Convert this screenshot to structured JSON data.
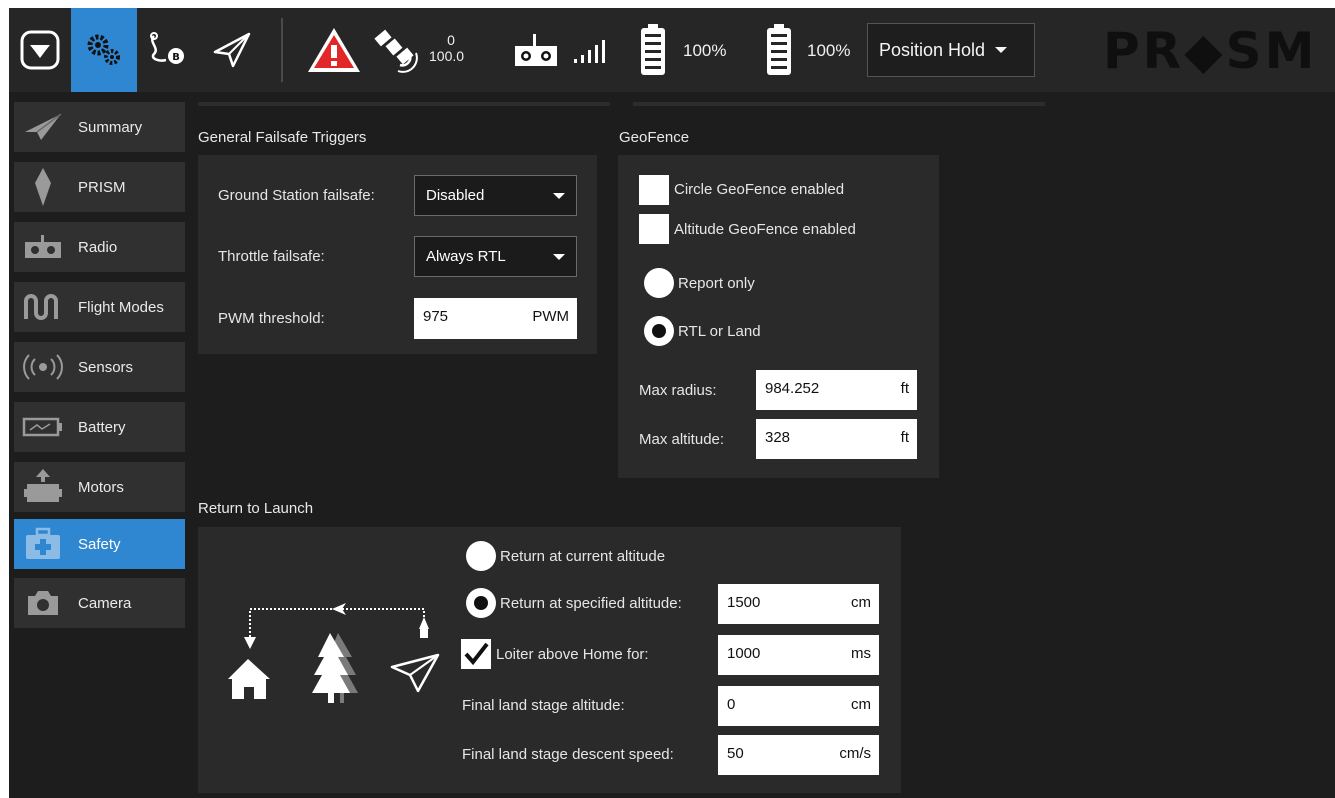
{
  "topbar": {
    "altitude_top": "0",
    "altitude_bottom": "100.0",
    "battery1_percent": "100%",
    "battery2_percent": "100%",
    "flight_mode": "Position Hold",
    "logo_text": "PR◆SM"
  },
  "sidebar": {
    "items": [
      {
        "label": "Summary",
        "icon": "paper-plane-icon"
      },
      {
        "label": "PRISM",
        "icon": "prism-diamond-icon"
      },
      {
        "label": "Radio",
        "icon": "radio-transmitter-icon"
      },
      {
        "label": "Flight Modes",
        "icon": "flight-modes-icon"
      },
      {
        "label": "Sensors",
        "icon": "sensors-icon"
      },
      {
        "label": "Battery",
        "icon": "battery-icon"
      },
      {
        "label": "Motors",
        "icon": "motor-icon"
      },
      {
        "label": "Safety",
        "icon": "first-aid-kit-icon"
      },
      {
        "label": "Camera",
        "icon": "camera-icon"
      }
    ],
    "active": "Safety"
  },
  "failsafe": {
    "title": "General Failsafe Triggers",
    "gcs_label": "Ground Station failsafe:",
    "gcs_value": "Disabled",
    "throttle_label": "Throttle failsafe:",
    "throttle_value": "Always RTL",
    "pwm_label": "PWM threshold:",
    "pwm_value": "975",
    "pwm_unit": "PWM"
  },
  "geofence": {
    "title": "GeoFence",
    "circle_label": "Circle GeoFence enabled",
    "circle_checked": false,
    "altitude_label": "Altitude GeoFence enabled",
    "altitude_checked": false,
    "report_only_label": "Report only",
    "rtl_land_label": "RTL or Land",
    "selected_action": "RTL or Land",
    "max_radius_label": "Max radius:",
    "max_radius_value": "984.252",
    "max_radius_unit": "ft",
    "max_altitude_label": "Max altitude:",
    "max_altitude_value": "328",
    "max_altitude_unit": "ft"
  },
  "rtl": {
    "title": "Return to Launch",
    "current_alt_label": "Return at current altitude",
    "specified_alt_label": "Return at specified altitude:",
    "selected_option": "Return at specified altitude:",
    "specified_alt_value": "1500",
    "specified_alt_unit": "cm",
    "loiter_label": "Loiter above Home for:",
    "loiter_checked": true,
    "loiter_value": "1000",
    "loiter_unit": "ms",
    "final_alt_label": "Final land stage altitude:",
    "final_alt_value": "0",
    "final_alt_unit": "cm",
    "final_speed_label": "Final land stage descent speed:",
    "final_speed_value": "50",
    "final_speed_unit": "cm/s"
  },
  "colors": {
    "accent": "#2f86d1",
    "topbar": "#262626",
    "background": "#1d1d1d",
    "panel": "#2a2a2a",
    "warning": "#e12727"
  }
}
